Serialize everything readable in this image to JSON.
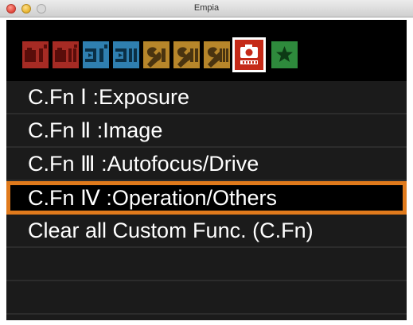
{
  "window": {
    "title": "Empia"
  },
  "tabs": [
    {
      "icon": "camera-shooting-1-icon",
      "color": "#a62b24"
    },
    {
      "icon": "camera-shooting-2-icon",
      "color": "#a62b24"
    },
    {
      "icon": "playback-1-icon",
      "color": "#2f7fb0"
    },
    {
      "icon": "playback-2-icon",
      "color": "#2f7fb0"
    },
    {
      "icon": "setup-wrench-1-icon",
      "color": "#b7862a"
    },
    {
      "icon": "setup-wrench-2-icon",
      "color": "#b7862a"
    },
    {
      "icon": "setup-wrench-3-icon",
      "color": "#b7862a"
    },
    {
      "icon": "custom-functions-camera-icon",
      "color": "#c52a18",
      "active": true
    },
    {
      "icon": "my-menu-star-icon",
      "color": "#2e8a3c"
    }
  ],
  "menu": {
    "items": [
      {
        "label": "C.Fn Ⅰ :Exposure"
      },
      {
        "label": "C.Fn Ⅱ :Image"
      },
      {
        "label": "C.Fn Ⅲ :Autofocus/Drive"
      },
      {
        "label": "C.Fn Ⅳ :Operation/Others",
        "selected": true
      },
      {
        "label": "Clear all Custom Func. (C.Fn)"
      }
    ],
    "selection_color": "#e07a1c"
  }
}
